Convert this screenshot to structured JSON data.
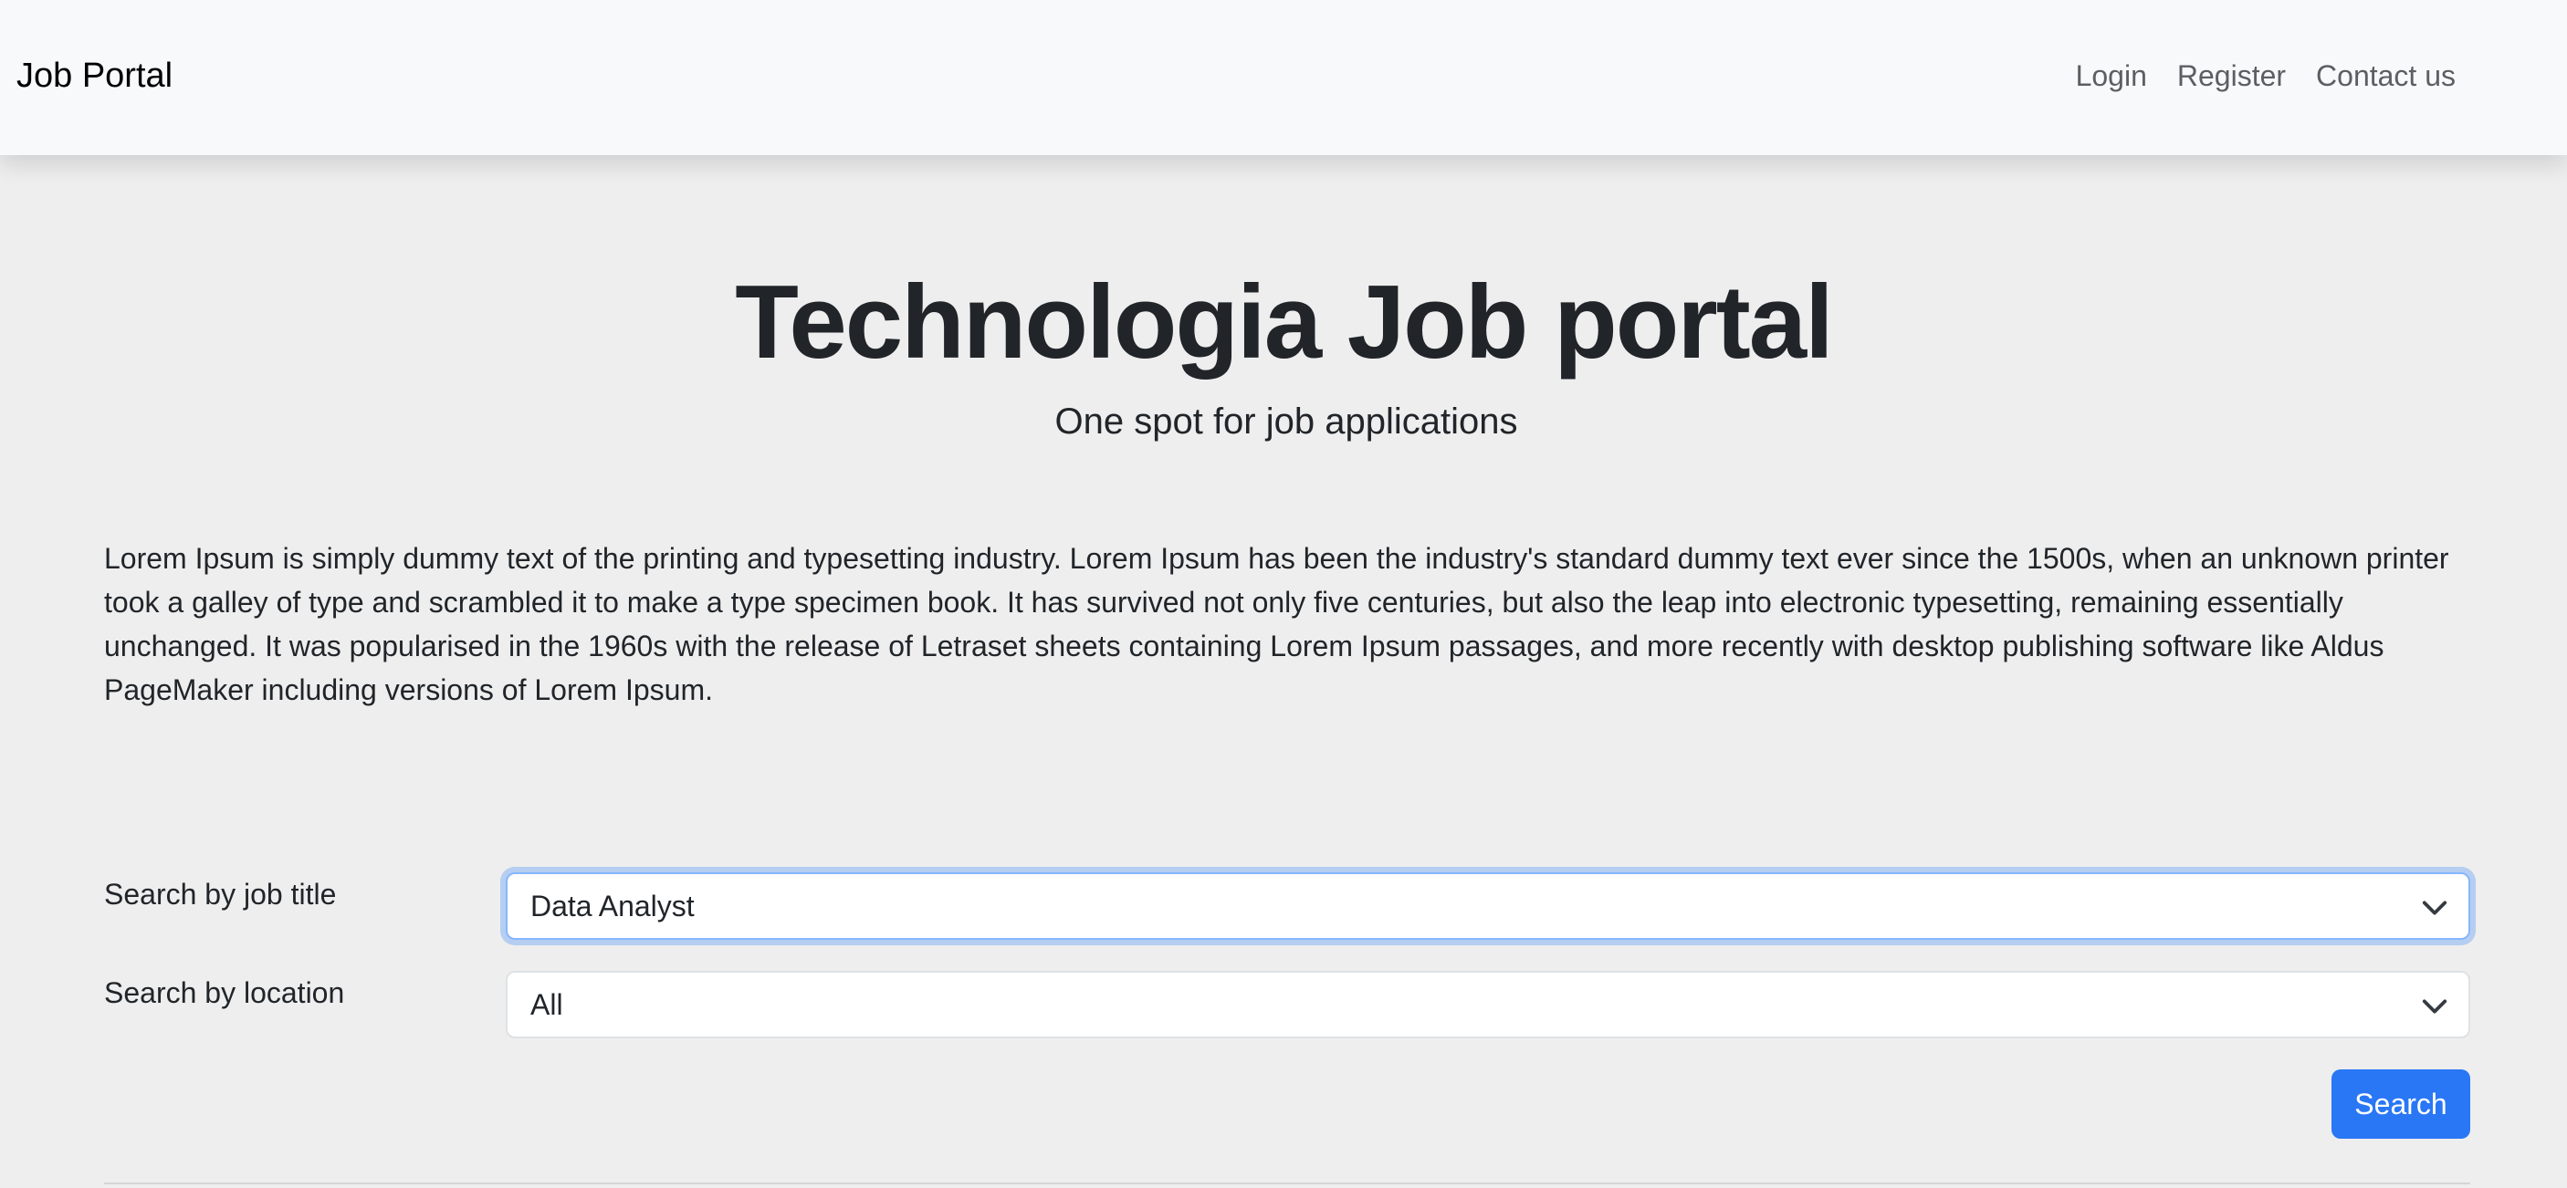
{
  "navbar": {
    "brand": "Job Portal",
    "links": [
      "Login",
      "Register",
      "Contact us"
    ]
  },
  "hero": {
    "title": "Technologia Job portal",
    "subtitle": "One spot for job applications"
  },
  "description": "Lorem Ipsum is simply dummy text of the printing and typesetting industry. Lorem Ipsum has been the industry's standard dummy text ever since the 1500s, when an unknown printer took a galley of type and scrambled it to make a type specimen book. It has survived not only five centuries, but also the leap into electronic typesetting, remaining essentially unchanged. It was popularised in the 1960s with the release of Letraset sheets containing Lorem Ipsum passages, and more recently with desktop publishing software like Aldus PageMaker including versions of Lorem Ipsum.",
  "search": {
    "job_title_label": "Search by job title",
    "job_title_value": "Data Analyst",
    "location_label": "Search by location",
    "location_value": "All",
    "button_label": "Search"
  },
  "icons": {
    "select_arrow": "chevron-down-icon"
  },
  "colors": {
    "navbar_bg": "#f8f9fa",
    "page_bg": "#eeeeee",
    "primary_button": "#2977f5",
    "focus_ring": "#86b7fe"
  }
}
